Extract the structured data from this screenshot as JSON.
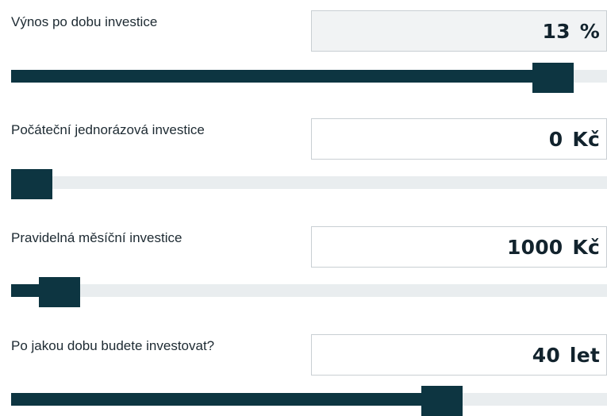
{
  "calculator": {
    "rows": [
      {
        "label": "Výnos po dobu investice",
        "value": "13",
        "unit": "%",
        "slider_fraction": 0.94
      },
      {
        "label": "Počáteční jednorázová investice",
        "value": "0",
        "unit": "Kč",
        "slider_fraction": 0.0
      },
      {
        "label": "Pravidelná měsíční investice",
        "value": "1000",
        "unit": "Kč",
        "slider_fraction": 0.05
      },
      {
        "label": "Po jakou dobu budete investovat?",
        "value": "40",
        "unit": "let",
        "slider_fraction": 0.74
      }
    ]
  },
  "colors": {
    "accent": "#0d3541",
    "track": "#e9edef",
    "readonly_field": "#f1f3f4"
  }
}
